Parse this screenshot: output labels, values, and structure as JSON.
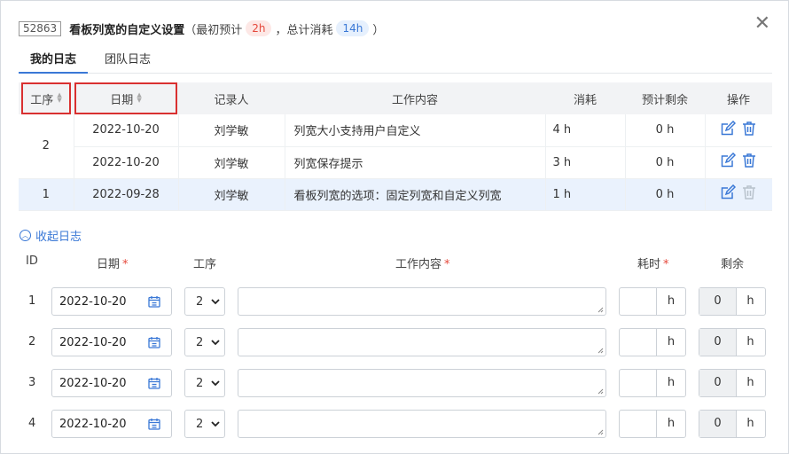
{
  "dialog": {
    "id_badge": "52863",
    "title": "看板列宽的自定义设置",
    "initial_label": "（最初预计",
    "initial_value": "2h",
    "sep": "，总计消耗",
    "total_value": "14h",
    "close_paren": "）",
    "close_icon": "close-icon"
  },
  "tabs": [
    {
      "label": "我的日志",
      "active": true
    },
    {
      "label": "团队日志",
      "active": false
    }
  ],
  "log": {
    "headers": [
      "工序",
      "日期",
      "记录人",
      "工作内容",
      "消耗",
      "预计剩余",
      "操作"
    ],
    "rows": [
      {
        "date": "2022-10-20",
        "recorder": "刘学敏",
        "content": "列宽大小支持用户自定义",
        "used": "4 h",
        "remain": "0 h"
      },
      {
        "date": "2022-10-20",
        "recorder": "刘学敏",
        "content": "列宽保存提示",
        "used": "3 h",
        "remain": "0 h"
      },
      {
        "date": "2022-09-28",
        "recorder": "刘学敏",
        "content": "看板列宽的选项：固定列宽和自定义列宽",
        "used": "1 h",
        "remain": "0 h"
      }
    ],
    "groups": [
      "2",
      "1"
    ]
  },
  "collapse_label": "收起日志",
  "form": {
    "headers": {
      "id": "ID",
      "date": "日期",
      "step": "工序",
      "content": "工作内容",
      "hours": "耗时",
      "remain": "剩余",
      "required_mark": "*"
    },
    "rows": [
      {
        "id": "1",
        "date": "2022-10-20",
        "step": "2",
        "hours_unit": "h",
        "remain": "0",
        "remain_unit": "h"
      },
      {
        "id": "2",
        "date": "2022-10-20",
        "step": "2",
        "hours_unit": "h",
        "remain": "0",
        "remain_unit": "h"
      },
      {
        "id": "3",
        "date": "2022-10-20",
        "step": "2",
        "hours_unit": "h",
        "remain": "0",
        "remain_unit": "h"
      },
      {
        "id": "4",
        "date": "2022-10-20",
        "step": "2",
        "hours_unit": "h",
        "remain": "0",
        "remain_unit": "h"
      }
    ]
  },
  "colors": {
    "accent": "#3a78d6",
    "highlight_row": "#eaf2fd",
    "red_box": "#d93030",
    "danger": "#e5483b"
  }
}
